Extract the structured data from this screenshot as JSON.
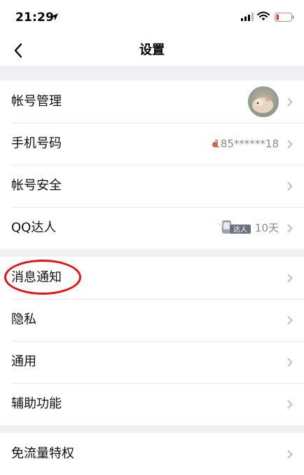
{
  "status_bar": {
    "time": "21:29"
  },
  "nav": {
    "title": "设置"
  },
  "group1": {
    "account": {
      "label": "帐号管理"
    },
    "phone": {
      "label": "手机号码",
      "value": "185******18"
    },
    "security": {
      "label": "帐号安全"
    },
    "qq_daren": {
      "label": "QQ达人",
      "badge_text": "达人",
      "days": "10天"
    }
  },
  "group2": {
    "notifications": {
      "label": "消息通知"
    },
    "privacy": {
      "label": "隐私"
    },
    "general": {
      "label": "通用"
    },
    "accessibility": {
      "label": "辅助功能"
    }
  },
  "group3": {
    "free_data": {
      "label": "免流量特权"
    }
  },
  "colors": {
    "background": "#efeff4",
    "annotation_circle": "#e31414",
    "red_dot": "#ef5a3c"
  }
}
